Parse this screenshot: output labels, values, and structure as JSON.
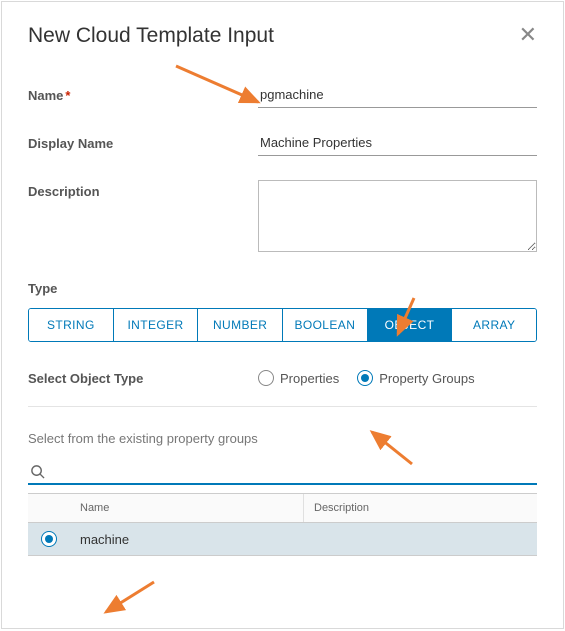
{
  "dialog": {
    "title": "New Cloud Template Input",
    "close_glyph": "✕"
  },
  "form": {
    "name_label": "Name",
    "name_value": "pgmachine",
    "display_name_label": "Display Name",
    "display_name_value": "Machine Properties",
    "description_label": "Description",
    "description_value": ""
  },
  "type": {
    "label": "Type",
    "options": [
      "STRING",
      "INTEGER",
      "NUMBER",
      "BOOLEAN",
      "OBJECT",
      "ARRAY"
    ],
    "selected": "OBJECT"
  },
  "object_type": {
    "label": "Select Object Type",
    "options": [
      {
        "label": "Properties",
        "checked": false
      },
      {
        "label": "Property Groups",
        "checked": true
      }
    ]
  },
  "property_groups": {
    "section_title": "Select from the existing property groups",
    "search_value": "",
    "columns": {
      "name": "Name",
      "description": "Description"
    },
    "rows": [
      {
        "name": "machine",
        "description": "",
        "selected": true
      }
    ]
  },
  "colors": {
    "accent": "#0079b8",
    "arrow": "#ed7d31"
  }
}
